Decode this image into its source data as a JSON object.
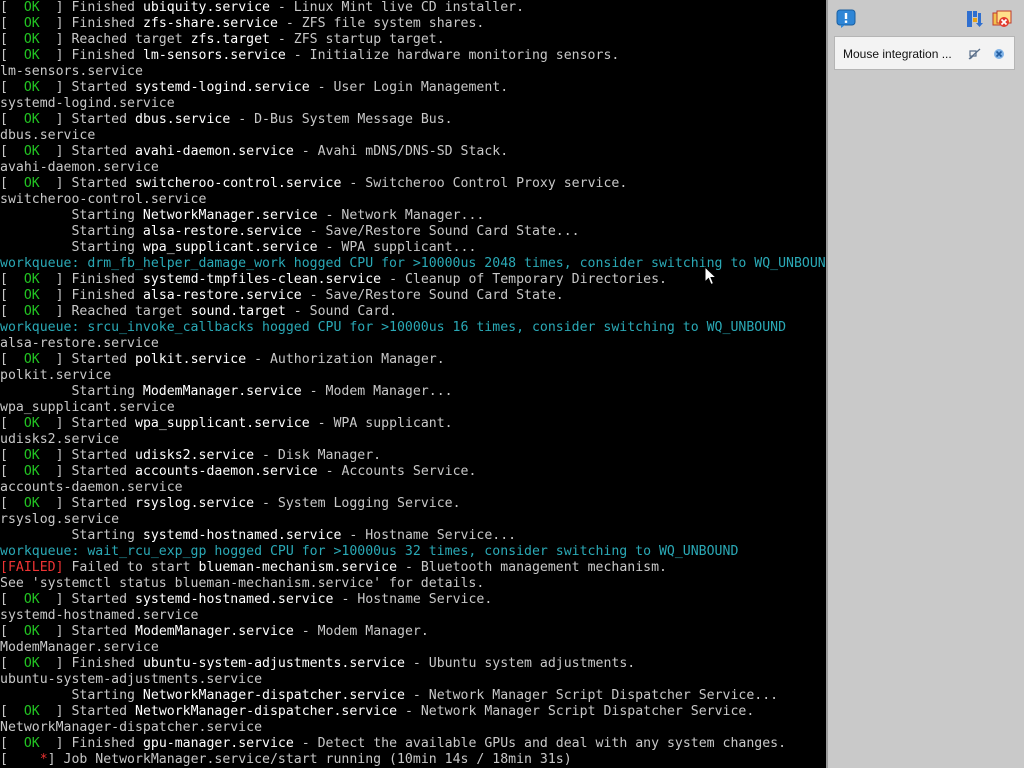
{
  "console": {
    "lines": [
      [
        [
          "grey",
          "[  "
        ],
        [
          "green",
          "OK"
        ],
        [
          "grey",
          "  ] Finished "
        ],
        [
          "white",
          "ubiquity.service"
        ],
        [
          "grey",
          " - Linux Mint live CD installer."
        ]
      ],
      [
        [
          "grey",
          "[  "
        ],
        [
          "green",
          "OK"
        ],
        [
          "grey",
          "  ] Finished "
        ],
        [
          "white",
          "zfs-share.service"
        ],
        [
          "grey",
          " - ZFS file system shares."
        ]
      ],
      [
        [
          "grey",
          "[  "
        ],
        [
          "green",
          "OK"
        ],
        [
          "grey",
          "  ] Reached target "
        ],
        [
          "white",
          "zfs.target"
        ],
        [
          "grey",
          " - ZFS startup target."
        ]
      ],
      [
        [
          "grey",
          "[  "
        ],
        [
          "green",
          "OK"
        ],
        [
          "grey",
          "  ] Finished "
        ],
        [
          "white",
          "lm-sensors.service"
        ],
        [
          "grey",
          " - Initialize hardware monitoring sensors."
        ]
      ],
      [
        [
          "grey",
          "lm-sensors.service"
        ]
      ],
      [
        [
          "grey",
          "[  "
        ],
        [
          "green",
          "OK"
        ],
        [
          "grey",
          "  ] Started "
        ],
        [
          "white",
          "systemd-logind.service"
        ],
        [
          "grey",
          " - User Login Management."
        ]
      ],
      [
        [
          "grey",
          "systemd-logind.service"
        ]
      ],
      [
        [
          "grey",
          "[  "
        ],
        [
          "green",
          "OK"
        ],
        [
          "grey",
          "  ] Started "
        ],
        [
          "white",
          "dbus.service"
        ],
        [
          "grey",
          " - D-Bus System Message Bus."
        ]
      ],
      [
        [
          "grey",
          "dbus.service"
        ]
      ],
      [
        [
          "grey",
          "[  "
        ],
        [
          "green",
          "OK"
        ],
        [
          "grey",
          "  ] Started "
        ],
        [
          "white",
          "avahi-daemon.service"
        ],
        [
          "grey",
          " - Avahi mDNS/DNS-SD Stack."
        ]
      ],
      [
        [
          "grey",
          "avahi-daemon.service"
        ]
      ],
      [
        [
          "grey",
          "[  "
        ],
        [
          "green",
          "OK"
        ],
        [
          "grey",
          "  ] Started "
        ],
        [
          "white",
          "switcheroo-control.service"
        ],
        [
          "grey",
          " - Switcheroo Control Proxy service."
        ]
      ],
      [
        [
          "grey",
          "switcheroo-control.service"
        ]
      ],
      [
        [
          "grey",
          "         Starting "
        ],
        [
          "white",
          "NetworkManager.service"
        ],
        [
          "grey",
          " - Network Manager..."
        ]
      ],
      [
        [
          "grey",
          "         Starting "
        ],
        [
          "white",
          "alsa-restore.service"
        ],
        [
          "grey",
          " - Save/Restore Sound Card State..."
        ]
      ],
      [
        [
          "grey",
          "         Starting "
        ],
        [
          "white",
          "wpa_supplicant.service"
        ],
        [
          "grey",
          " - WPA supplicant..."
        ]
      ],
      [
        [
          "cyan",
          "workqueue: drm_fb_helper_damage_work hogged CPU for >10000us 2048 times, consider switching to WQ_UNBOUND"
        ]
      ],
      [
        [
          "grey",
          "[  "
        ],
        [
          "green",
          "OK"
        ],
        [
          "grey",
          "  ] Finished "
        ],
        [
          "white",
          "systemd-tmpfiles-clean.service"
        ],
        [
          "grey",
          " - Cleanup of Temporary Directories."
        ]
      ],
      [
        [
          "grey",
          "[  "
        ],
        [
          "green",
          "OK"
        ],
        [
          "grey",
          "  ] Finished "
        ],
        [
          "white",
          "alsa-restore.service"
        ],
        [
          "grey",
          " - Save/Restore Sound Card State."
        ]
      ],
      [
        [
          "grey",
          "[  "
        ],
        [
          "green",
          "OK"
        ],
        [
          "grey",
          "  ] Reached target "
        ],
        [
          "white",
          "sound.target"
        ],
        [
          "grey",
          " - Sound Card."
        ]
      ],
      [
        [
          "cyan",
          "workqueue: srcu_invoke_callbacks hogged CPU for >10000us 16 times, consider switching to WQ_UNBOUND"
        ]
      ],
      [
        [
          "grey",
          "alsa-restore.service"
        ]
      ],
      [
        [
          "grey",
          "[  "
        ],
        [
          "green",
          "OK"
        ],
        [
          "grey",
          "  ] Started "
        ],
        [
          "white",
          "polkit.service"
        ],
        [
          "grey",
          " - Authorization Manager."
        ]
      ],
      [
        [
          "grey",
          "polkit.service"
        ]
      ],
      [
        [
          "grey",
          "         Starting "
        ],
        [
          "white",
          "ModemManager.service"
        ],
        [
          "grey",
          " - Modem Manager..."
        ]
      ],
      [
        [
          "grey",
          "wpa_supplicant.service"
        ]
      ],
      [
        [
          "grey",
          "[  "
        ],
        [
          "green",
          "OK"
        ],
        [
          "grey",
          "  ] Started "
        ],
        [
          "white",
          "wpa_supplicant.service"
        ],
        [
          "grey",
          " - WPA supplicant."
        ]
      ],
      [
        [
          "grey",
          "udisks2.service"
        ]
      ],
      [
        [
          "grey",
          "[  "
        ],
        [
          "green",
          "OK"
        ],
        [
          "grey",
          "  ] Started "
        ],
        [
          "white",
          "udisks2.service"
        ],
        [
          "grey",
          " - Disk Manager."
        ]
      ],
      [
        [
          "grey",
          "[  "
        ],
        [
          "green",
          "OK"
        ],
        [
          "grey",
          "  ] Started "
        ],
        [
          "white",
          "accounts-daemon.service"
        ],
        [
          "grey",
          " - Accounts Service."
        ]
      ],
      [
        [
          "grey",
          "accounts-daemon.service"
        ]
      ],
      [
        [
          "grey",
          "[  "
        ],
        [
          "green",
          "OK"
        ],
        [
          "grey",
          "  ] Started "
        ],
        [
          "white",
          "rsyslog.service"
        ],
        [
          "grey",
          " - System Logging Service."
        ]
      ],
      [
        [
          "grey",
          "rsyslog.service"
        ]
      ],
      [
        [
          "grey",
          "         Starting "
        ],
        [
          "white",
          "systemd-hostnamed.service"
        ],
        [
          "grey",
          " - Hostname Service..."
        ]
      ],
      [
        [
          "cyan",
          "workqueue: wait_rcu_exp_gp hogged CPU for >10000us 32 times, consider switching to WQ_UNBOUND"
        ]
      ],
      [
        [
          "red",
          "[FAILED]"
        ],
        [
          "grey",
          " Failed to start "
        ],
        [
          "white",
          "blueman-mechanism.service"
        ],
        [
          "grey",
          " - Bluetooth management mechanism."
        ]
      ],
      [
        [
          "grey",
          "See 'systemctl status blueman-mechanism.service' for details."
        ]
      ],
      [
        [
          "grey",
          "[  "
        ],
        [
          "green",
          "OK"
        ],
        [
          "grey",
          "  ] Started "
        ],
        [
          "white",
          "systemd-hostnamed.service"
        ],
        [
          "grey",
          " - Hostname Service."
        ]
      ],
      [
        [
          "grey",
          "systemd-hostnamed.service"
        ]
      ],
      [
        [
          "grey",
          "[  "
        ],
        [
          "green",
          "OK"
        ],
        [
          "grey",
          "  ] Started "
        ],
        [
          "white",
          "ModemManager.service"
        ],
        [
          "grey",
          " - Modem Manager."
        ]
      ],
      [
        [
          "grey",
          "ModemManager.service"
        ]
      ],
      [
        [
          "grey",
          "[  "
        ],
        [
          "green",
          "OK"
        ],
        [
          "grey",
          "  ] Finished "
        ],
        [
          "white",
          "ubuntu-system-adjustments.service"
        ],
        [
          "grey",
          " - Ubuntu system adjustments."
        ]
      ],
      [
        [
          "grey",
          "ubuntu-system-adjustments.service"
        ]
      ],
      [
        [
          "grey",
          "         Starting "
        ],
        [
          "white",
          "NetworkManager-dispatcher.service"
        ],
        [
          "grey",
          " - Network Manager Script Dispatcher Service..."
        ]
      ],
      [
        [
          "grey",
          "[  "
        ],
        [
          "green",
          "OK"
        ],
        [
          "grey",
          "  ] Started "
        ],
        [
          "white",
          "NetworkManager-dispatcher.service"
        ],
        [
          "grey",
          " - Network Manager Script Dispatcher Service."
        ]
      ],
      [
        [
          "grey",
          "NetworkManager-dispatcher.service"
        ]
      ],
      [
        [
          "grey",
          "[  "
        ],
        [
          "green",
          "OK"
        ],
        [
          "grey",
          "  ] Finished "
        ],
        [
          "white",
          "gpu-manager.service"
        ],
        [
          "grey",
          " - Detect the available GPUs and deal with any system changes."
        ]
      ],
      [
        [
          "grey",
          "[    "
        ],
        [
          "red",
          "*"
        ],
        [
          "grey",
          "] Job NetworkManager.service/start running (10min 14s / 18min 31s)"
        ]
      ]
    ]
  },
  "vbox_panel": {
    "toolbar_icons": [
      "notification-center-icon",
      "sort-icon",
      "close-all-icon"
    ],
    "notification": {
      "text": "Mouse integration ...",
      "icons": [
        "mute-icon",
        "close-icon"
      ]
    }
  },
  "colors": {
    "ok": "#22c422",
    "failed": "#ee3333",
    "workqueue": "#2aa9b6",
    "service_name": "#ffffff",
    "text": "#c8c8c8",
    "panel_bg": "#c9c9c9"
  }
}
